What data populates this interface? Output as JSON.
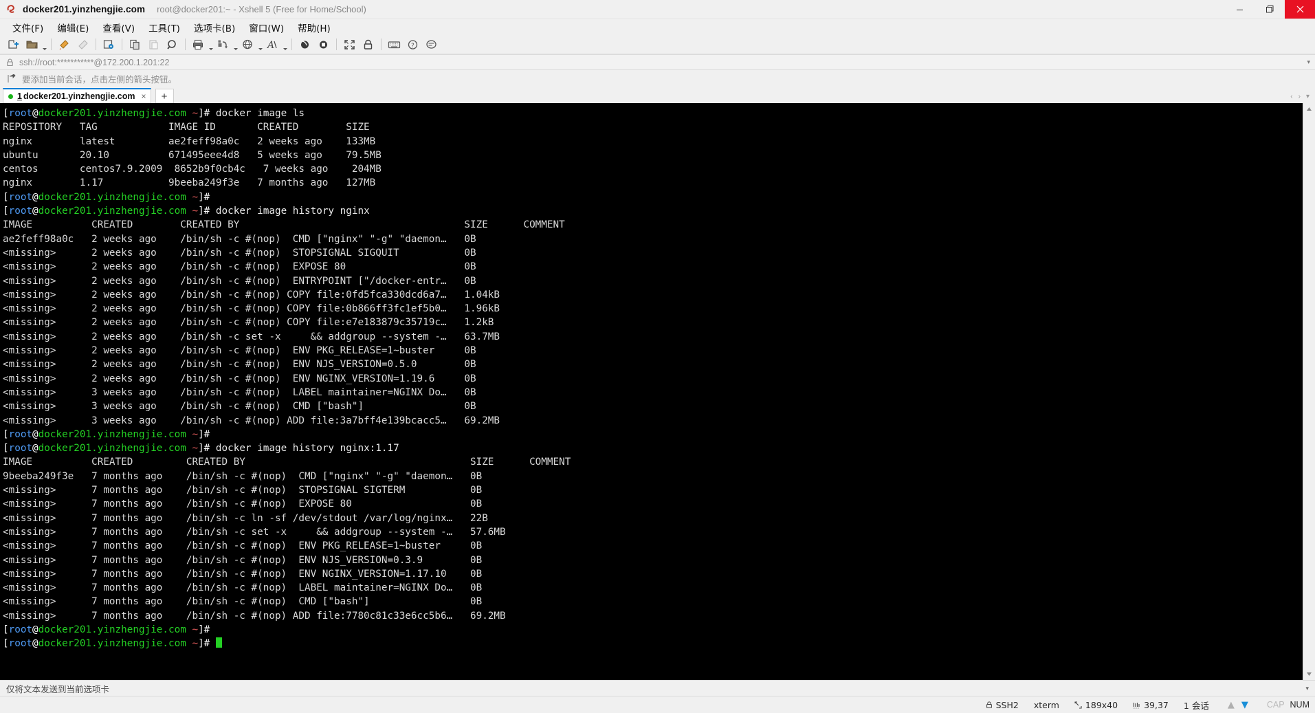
{
  "window": {
    "title": "docker201.yinzhengjie.com",
    "subtitle": "root@docker201:~ - Xshell 5 (Free for Home/School)",
    "minimize_label": "Minimize",
    "maximize_label": "Restore",
    "close_label": "Close"
  },
  "menubar": {
    "items": [
      {
        "label": "文件(F)",
        "name": "menu-file"
      },
      {
        "label": "编辑(E)",
        "name": "menu-edit"
      },
      {
        "label": "查看(V)",
        "name": "menu-view"
      },
      {
        "label": "工具(T)",
        "name": "menu-tools"
      },
      {
        "label": "选项卡(B)",
        "name": "menu-tab"
      },
      {
        "label": "窗口(W)",
        "name": "menu-window"
      },
      {
        "label": "帮助(H)",
        "name": "menu-help"
      }
    ]
  },
  "toolbar": {
    "icons": [
      "new-session-icon",
      "open-folder-icon",
      "separator",
      "highlight-icon",
      "clear-icon",
      "separator",
      "properties-icon",
      "separator",
      "copy-icon",
      "paste-icon",
      "find-icon",
      "separator",
      "print-icon",
      "transfer-icon",
      "browser-icon",
      "font-icon",
      "separator",
      "ssh-tunnel-icon",
      "compose-icon",
      "separator",
      "fullscreen-icon",
      "lock-icon",
      "separator",
      "keyboard-icon",
      "help-icon",
      "feedback-icon"
    ]
  },
  "address": {
    "value": "ssh://root:***********@172.200.1.201:22",
    "lock_icon": "lock-icon",
    "dropdown_icon": "chevron-down-icon"
  },
  "notice": {
    "icon": "add-session-icon",
    "text": "要添加当前会话，点击左侧的箭头按钮。"
  },
  "tabs": {
    "items": [
      {
        "number": "1",
        "label": "docker201.yinzhengjie.com",
        "active": true,
        "status": "connected"
      }
    ],
    "close_label": "×",
    "add_label": "+",
    "scroll_left": "‹",
    "scroll_right": "›",
    "menu": "▾"
  },
  "terminal": {
    "prompt": {
      "open_bracket": "[",
      "user": "root",
      "at": "@",
      "host": "docker201.yinzhengjie.com",
      "space": " ",
      "tilde": "~",
      "close": "]# "
    },
    "lines": [
      {
        "type": "prompt",
        "cmd": "docker image ls"
      },
      {
        "type": "out",
        "text": "REPOSITORY   TAG            IMAGE ID       CREATED        SIZE"
      },
      {
        "type": "out",
        "text": "nginx        latest         ae2feff98a0c   2 weeks ago    133MB"
      },
      {
        "type": "out",
        "text": "ubuntu       20.10          671495eee4d8   5 weeks ago    79.5MB"
      },
      {
        "type": "out",
        "text": "centos       centos7.9.2009  8652b9f0cb4c   7 weeks ago    204MB"
      },
      {
        "type": "out",
        "text": "nginx        1.17           9beeba249f3e   7 months ago   127MB"
      },
      {
        "type": "prompt",
        "cmd": ""
      },
      {
        "type": "prompt",
        "cmd": "docker image history nginx"
      },
      {
        "type": "out",
        "text": "IMAGE          CREATED        CREATED BY                                      SIZE      COMMENT"
      },
      {
        "type": "out",
        "text": "ae2feff98a0c   2 weeks ago    /bin/sh -c #(nop)  CMD [\"nginx\" \"-g\" \"daemon…   0B"
      },
      {
        "type": "out",
        "text": "<missing>      2 weeks ago    /bin/sh -c #(nop)  STOPSIGNAL SIGQUIT           0B"
      },
      {
        "type": "out",
        "text": "<missing>      2 weeks ago    /bin/sh -c #(nop)  EXPOSE 80                    0B"
      },
      {
        "type": "out",
        "text": "<missing>      2 weeks ago    /bin/sh -c #(nop)  ENTRYPOINT [\"/docker-entr…   0B"
      },
      {
        "type": "out",
        "text": "<missing>      2 weeks ago    /bin/sh -c #(nop) COPY file:0fd5fca330dcd6a7…   1.04kB"
      },
      {
        "type": "out",
        "text": "<missing>      2 weeks ago    /bin/sh -c #(nop) COPY file:0b866ff3fc1ef5b0…   1.96kB"
      },
      {
        "type": "out",
        "text": "<missing>      2 weeks ago    /bin/sh -c #(nop) COPY file:e7e183879c35719c…   1.2kB"
      },
      {
        "type": "out",
        "text": "<missing>      2 weeks ago    /bin/sh -c set -x     && addgroup --system -…   63.7MB"
      },
      {
        "type": "out",
        "text": "<missing>      2 weeks ago    /bin/sh -c #(nop)  ENV PKG_RELEASE=1~buster     0B"
      },
      {
        "type": "out",
        "text": "<missing>      2 weeks ago    /bin/sh -c #(nop)  ENV NJS_VERSION=0.5.0        0B"
      },
      {
        "type": "out",
        "text": "<missing>      2 weeks ago    /bin/sh -c #(nop)  ENV NGINX_VERSION=1.19.6     0B"
      },
      {
        "type": "out",
        "text": "<missing>      3 weeks ago    /bin/sh -c #(nop)  LABEL maintainer=NGINX Do…   0B"
      },
      {
        "type": "out",
        "text": "<missing>      3 weeks ago    /bin/sh -c #(nop)  CMD [\"bash\"]                 0B"
      },
      {
        "type": "out",
        "text": "<missing>      3 weeks ago    /bin/sh -c #(nop) ADD file:3a7bff4e139bcacc5…   69.2MB"
      },
      {
        "type": "prompt",
        "cmd": ""
      },
      {
        "type": "prompt",
        "cmd": "docker image history nginx:1.17"
      },
      {
        "type": "out",
        "text": "IMAGE          CREATED         CREATED BY                                      SIZE      COMMENT"
      },
      {
        "type": "out",
        "text": "9beeba249f3e   7 months ago    /bin/sh -c #(nop)  CMD [\"nginx\" \"-g\" \"daemon…   0B"
      },
      {
        "type": "out",
        "text": "<missing>      7 months ago    /bin/sh -c #(nop)  STOPSIGNAL SIGTERM           0B"
      },
      {
        "type": "out",
        "text": "<missing>      7 months ago    /bin/sh -c #(nop)  EXPOSE 80                    0B"
      },
      {
        "type": "out",
        "text": "<missing>      7 months ago    /bin/sh -c ln -sf /dev/stdout /var/log/nginx…   22B"
      },
      {
        "type": "out",
        "text": "<missing>      7 months ago    /bin/sh -c set -x     && addgroup --system -…   57.6MB"
      },
      {
        "type": "out",
        "text": "<missing>      7 months ago    /bin/sh -c #(nop)  ENV PKG_RELEASE=1~buster     0B"
      },
      {
        "type": "out",
        "text": "<missing>      7 months ago    /bin/sh -c #(nop)  ENV NJS_VERSION=0.3.9        0B"
      },
      {
        "type": "out",
        "text": "<missing>      7 months ago    /bin/sh -c #(nop)  ENV NGINX_VERSION=1.17.10    0B"
      },
      {
        "type": "out",
        "text": "<missing>      7 months ago    /bin/sh -c #(nop)  LABEL maintainer=NGINX Do…   0B"
      },
      {
        "type": "out",
        "text": "<missing>      7 months ago    /bin/sh -c #(nop)  CMD [\"bash\"]                 0B"
      },
      {
        "type": "out",
        "text": "<missing>      7 months ago    /bin/sh -c #(nop) ADD file:7780c81c33e6cc5b6…   69.2MB"
      },
      {
        "type": "prompt",
        "cmd": ""
      },
      {
        "type": "prompt-cursor",
        "cmd": ""
      }
    ]
  },
  "sendbar": {
    "text": "仅将文本发送到当前选项卡",
    "caret": "▾"
  },
  "statusbar": {
    "protocol": "SSH2",
    "terminal_type": "xterm",
    "size": "189x40",
    "cursor_pos": "39,37",
    "sessions": "1 会话",
    "cap": "CAP",
    "num": "NUM",
    "protocol_icon": "lock-icon",
    "size_icon": "resize-icon",
    "cursor_icon": "cursor-icon",
    "upload_icon": "arrow-up-icon",
    "download_icon": "arrow-down-icon"
  },
  "colors": {
    "accent": "#0a7fd6",
    "close_red": "#e81123",
    "terminal_bg": "#000000",
    "prompt_host": "#24d024",
    "prompt_user": "#4f9bf5",
    "prompt_tilde": "#e05a5a",
    "tab_connected": "#19b219"
  }
}
